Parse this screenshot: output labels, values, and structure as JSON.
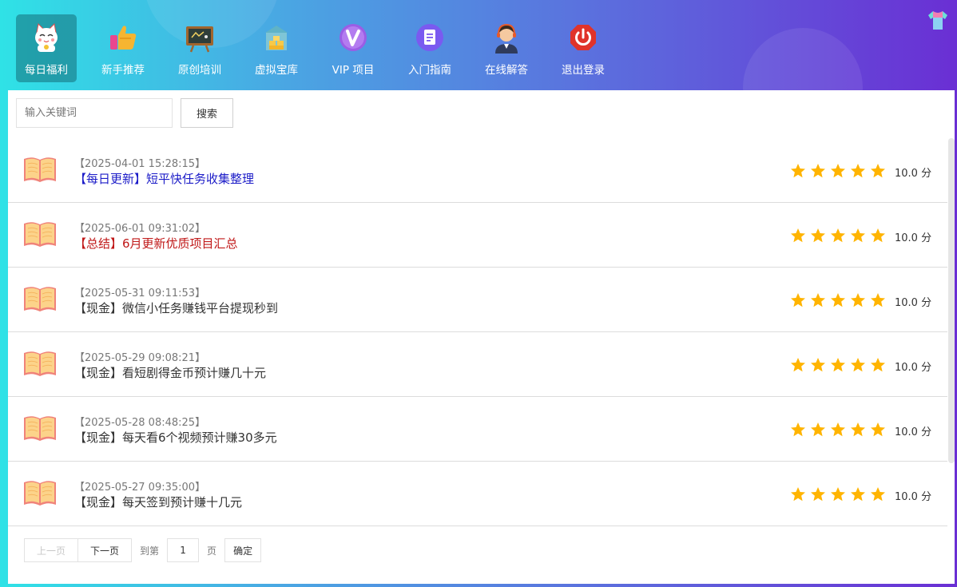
{
  "nav": {
    "items": [
      {
        "label": "每日福利",
        "icon": "lucky-cat-icon",
        "active": true
      },
      {
        "label": "新手推荐",
        "icon": "thumbs-up-icon",
        "active": false
      },
      {
        "label": "原创培训",
        "icon": "chalkboard-icon",
        "active": false
      },
      {
        "label": "虚拟宝库",
        "icon": "treasure-vault-icon",
        "active": false
      },
      {
        "label": "VIP 项目",
        "icon": "vip-badge-icon",
        "active": false
      },
      {
        "label": "入门指南",
        "icon": "guide-document-icon",
        "active": false
      },
      {
        "label": "在线解答",
        "icon": "customer-service-icon",
        "active": false
      },
      {
        "label": "退出登录",
        "icon": "power-off-icon",
        "active": false
      }
    ],
    "corner_icon": "t-shirt-icon"
  },
  "search": {
    "placeholder": "输入关键词",
    "value": "",
    "button_label": "搜索"
  },
  "list": {
    "items": [
      {
        "date": "【2025-04-01 15:28:15】",
        "title": "【每日更新】短平快任务收集整理",
        "title_color": "#1c1cc8",
        "rating": 5,
        "score": "10.0 分"
      },
      {
        "date": "【2025-06-01 09:31:02】",
        "title": "【总结】6月更新优质项目汇总",
        "title_color": "#c01818",
        "rating": 5,
        "score": "10.0 分"
      },
      {
        "date": "【2025-05-31 09:11:53】",
        "title": "【现金】微信小任务赚钱平台提现秒到",
        "title_color": "#333333",
        "rating": 5,
        "score": "10.0 分"
      },
      {
        "date": "【2025-05-29 09:08:21】",
        "title": "【现金】看短剧得金币预计赚几十元",
        "title_color": "#333333",
        "rating": 5,
        "score": "10.0 分"
      },
      {
        "date": "【2025-05-28 08:48:25】",
        "title": "【现金】每天看6个视频预计赚30多元",
        "title_color": "#333333",
        "rating": 5,
        "score": "10.0 分"
      },
      {
        "date": "【2025-05-27 09:35:00】",
        "title": "【现金】每天签到预计赚十几元",
        "title_color": "#333333",
        "rating": 5,
        "score": "10.0 分"
      }
    ],
    "item_icon": "open-book-icon",
    "star_color": "#ffb400"
  },
  "pagination": {
    "prev_label": "上一页",
    "next_label": "下一页",
    "goto_prefix": "到第",
    "page_value": "1",
    "page_suffix": "页",
    "confirm_label": "确定"
  }
}
